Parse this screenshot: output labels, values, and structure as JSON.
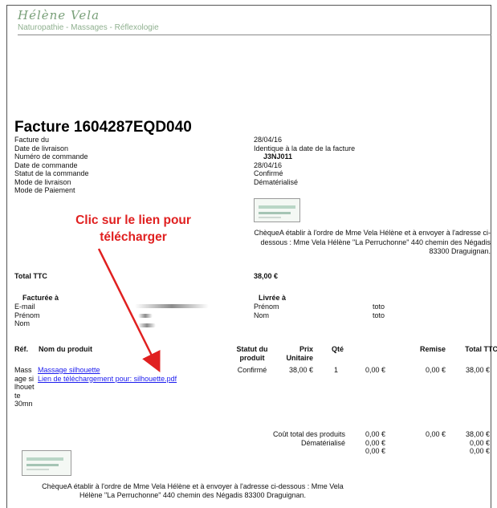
{
  "header": {
    "brand_name": "Hélène Vela",
    "brand_subtitle": "Naturopathie - Massages - Réflexologie"
  },
  "invoice": {
    "title": "Facture 1604287EQD040",
    "fields": [
      {
        "label": "Facture du",
        "value": "28/04/16"
      },
      {
        "label": "Date de livraison",
        "value": "Identique à la date de la facture"
      },
      {
        "label": "Numéro de commande",
        "value": "J3NJ011"
      },
      {
        "label": "Date de commande",
        "value": "28/04/16"
      },
      {
        "label": "Statut de la commande",
        "value": "Confirmé"
      },
      {
        "label": "Mode de livraison",
        "value": "Dématérialisé"
      },
      {
        "label": "Mode de Paiement",
        "value": ""
      }
    ],
    "payment_note": "ChèqueA établir à l'ordre de Mme Vela Hélène et à envoyer à l'adresse ci-dessous : Mme Vela Hélène \"La Perruchonne\" 440 chemin des Négadis 83300 Draguignan.",
    "total_label": "Total TTC",
    "total_value": "38,00 €"
  },
  "annotation": {
    "line1": "Clic sur le lien pour",
    "line2": "télécharger"
  },
  "billing": {
    "billed_header": "Facturée à",
    "billed_fields": [
      "E-mail",
      "Prénom",
      "Nom"
    ],
    "delivered_header": "Livrée à",
    "delivered_fields": [
      {
        "label": "Prénom",
        "value": "toto"
      },
      {
        "label": "Nom",
        "value": "toto"
      }
    ]
  },
  "table": {
    "headers": {
      "ref": "Réf.",
      "name": "Nom du produit",
      "status_1": "Statut du",
      "status_2": "produit",
      "price_1": "Prix",
      "price_2": "Unitaire",
      "qty": "Qté",
      "discount": "Remise",
      "total": "Total TTC"
    },
    "row": {
      "ref_lines": [
        "Mass",
        "age si",
        "lhouet",
        "te",
        "30mn"
      ],
      "product_link": "Massage silhouette",
      "download_link": "Lien de téléchargement pour: silhouette.pdf",
      "status": "Confirmé",
      "unit_price": "38,00 €",
      "qty": "1",
      "tax": "0,00 €",
      "discount": "0,00 €",
      "total": "38,00 €"
    },
    "summary": [
      {
        "label": "Coût total des produits",
        "tax": "0,00 €",
        "discount": "0,00 €",
        "total": "38,00 €"
      },
      {
        "label": "Dématérialisé",
        "tax": "0,00 €",
        "discount": "",
        "total": "0,00 €"
      },
      {
        "label": "",
        "tax": "0,00 €",
        "discount": "",
        "total": "0,00 €"
      }
    ]
  },
  "footer": {
    "payment_note": "ChèqueA établir à l'ordre de Mme Vela Hélène et à envoyer à l'adresse ci-dessous : Mme Vela Hélène \"La Perruchonne\" 440 chemin des Négadis 83300 Draguignan."
  },
  "colors": {
    "annotation": "#e02020",
    "link": "#1a1aee",
    "brand": "#7aa07a"
  }
}
